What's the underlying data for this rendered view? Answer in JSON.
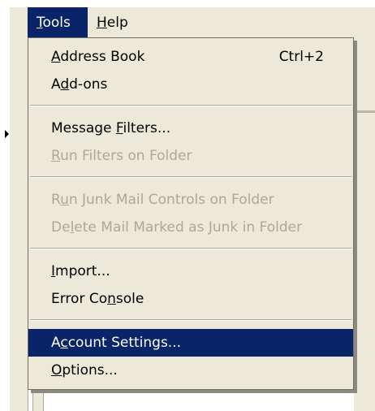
{
  "menubar": {
    "tools": {
      "label": "Tools",
      "mnemonic": "T",
      "rest": "ools"
    },
    "help": {
      "label": "Help",
      "mnemonic": "H",
      "rest": "elp"
    }
  },
  "menu": {
    "items": [
      {
        "label": "Address Book",
        "pre": "",
        "mn": "A",
        "post": "ddress Book",
        "shortcut": "Ctrl+2",
        "state": "enabled"
      },
      {
        "label": "Add-ons",
        "pre": "A",
        "mn": "d",
        "post": "d-ons",
        "shortcut": "",
        "state": "enabled"
      },
      {
        "label": "Message Filters...",
        "pre": "Message ",
        "mn": "F",
        "post": "ilters...",
        "shortcut": "",
        "state": "enabled"
      },
      {
        "label": "Run Filters on Folder",
        "pre": "",
        "mn": "R",
        "post": "un Filters on Folder",
        "shortcut": "",
        "state": "disabled"
      },
      {
        "label": "Run Junk Mail Controls on Folder",
        "pre": "R",
        "mn": "u",
        "post": "n Junk Mail Controls on Folder",
        "shortcut": "",
        "state": "disabled"
      },
      {
        "label": "Delete Mail Marked as Junk in Folder",
        "pre": "De",
        "mn": "l",
        "post": "ete Mail Marked as Junk in Folder",
        "shortcut": "",
        "state": "disabled"
      },
      {
        "label": "Import...",
        "pre": "",
        "mn": "I",
        "post": "mport...",
        "shortcut": "",
        "state": "enabled"
      },
      {
        "label": "Error Console",
        "pre": "Error Co",
        "mn": "n",
        "post": "sole",
        "shortcut": "",
        "state": "enabled"
      },
      {
        "label": "Account Settings...",
        "pre": "A",
        "mn": "c",
        "post": "count Settings...",
        "shortcut": "",
        "state": "selected"
      },
      {
        "label": "Options...",
        "pre": "",
        "mn": "O",
        "post": "ptions...",
        "shortcut": "",
        "state": "enabled"
      }
    ]
  },
  "colors": {
    "menu_bg": "#ece9d8",
    "highlight": "#0a246a",
    "disabled_text": "#aca899"
  }
}
